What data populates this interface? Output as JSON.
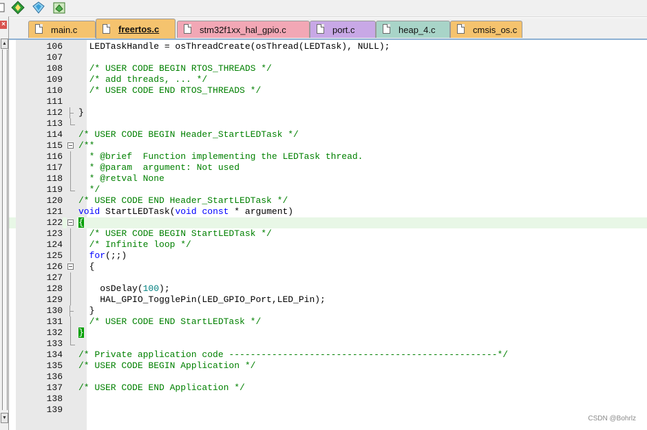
{
  "toolbar": {
    "icons": [
      "partial-icon",
      "diamond-arrows-icon",
      "component-icon",
      "green-box-icon"
    ]
  },
  "tabs": [
    {
      "label": "main.c",
      "color": "#f5c36e",
      "active": false
    },
    {
      "label": "freertos.c",
      "color": "#f5c36e",
      "active": true
    },
    {
      "label": "stm32f1xx_hal_gpio.c",
      "color": "#f2a7b5",
      "active": false
    },
    {
      "label": "port.c",
      "color": "#c8a8e6",
      "active": false
    },
    {
      "label": "heap_4.c",
      "color": "#a8d4c8",
      "active": false
    },
    {
      "label": "cmsis_os.c",
      "color": "#f5c36e",
      "active": false
    }
  ],
  "editor": {
    "lines": [
      {
        "n": "106",
        "code": "  LEDTaskHandle = osThreadCreate(osThread(LEDTask), NULL);"
      },
      {
        "n": "107",
        "code": ""
      },
      {
        "n": "108",
        "code": "  /* USER CODE BEGIN RTOS_THREADS */"
      },
      {
        "n": "109",
        "code": "  /* add threads, ... */"
      },
      {
        "n": "110",
        "code": "  /* USER CODE END RTOS_THREADS */"
      },
      {
        "n": "111",
        "code": ""
      },
      {
        "n": "112",
        "code": "}"
      },
      {
        "n": "113",
        "code": ""
      },
      {
        "n": "114",
        "code": "/* USER CODE BEGIN Header_StartLEDTask */"
      },
      {
        "n": "115",
        "code": "/**"
      },
      {
        "n": "116",
        "code": "  * @brief  Function implementing the LEDTask thread."
      },
      {
        "n": "117",
        "code": "  * @param  argument: Not used"
      },
      {
        "n": "118",
        "code": "  * @retval None"
      },
      {
        "n": "119",
        "code": "  */"
      },
      {
        "n": "120",
        "code": "/* USER CODE END Header_StartLEDTask */"
      },
      {
        "n": "121",
        "code": "void StartLEDTask(void const * argument)"
      },
      {
        "n": "122",
        "code": "{"
      },
      {
        "n": "123",
        "code": "  /* USER CODE BEGIN StartLEDTask */"
      },
      {
        "n": "124",
        "code": "  /* Infinite loop */"
      },
      {
        "n": "125",
        "code": "  for(;;)"
      },
      {
        "n": "126",
        "code": "  {"
      },
      {
        "n": "127",
        "code": ""
      },
      {
        "n": "128",
        "code": "    osDelay(100);"
      },
      {
        "n": "129",
        "code": "    HAL_GPIO_TogglePin(LED_GPIO_Port,LED_Pin);"
      },
      {
        "n": "130",
        "code": "  }"
      },
      {
        "n": "131",
        "code": "  /* USER CODE END StartLEDTask */"
      },
      {
        "n": "132",
        "code": "}"
      },
      {
        "n": "133",
        "code": ""
      },
      {
        "n": "134",
        "code": "/* Private application code --------------------------------------------------*/"
      },
      {
        "n": "135",
        "code": "/* USER CODE BEGIN Application */"
      },
      {
        "n": "136",
        "code": ""
      },
      {
        "n": "137",
        "code": "/* USER CODE END Application */"
      },
      {
        "n": "138",
        "code": ""
      },
      {
        "n": "139",
        "code": ""
      }
    ],
    "current_line": "122"
  },
  "watermark": "CSDN @Bohrlz"
}
